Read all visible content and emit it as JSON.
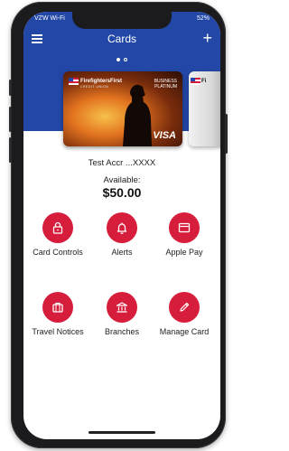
{
  "status": {
    "carrier": "VZW Wi-Fi",
    "battery": "52%"
  },
  "header": {
    "title": "Cards"
  },
  "card": {
    "brand": "FirefightersFirst",
    "brand_sub": "CREDIT UNION",
    "tier": [
      "BUSINESS",
      "PLATINUM"
    ],
    "network": "VISA",
    "next_card_brand": "Fi"
  },
  "account": {
    "name": "Test Accr ...XXXX",
    "available_label": "Available:",
    "available_amount": "$50.00"
  },
  "actions": [
    {
      "label": "Card Controls",
      "icon": "lock-icon"
    },
    {
      "label": "Alerts",
      "icon": "bell-icon"
    },
    {
      "label": "Apple Pay",
      "icon": "wallet-icon"
    },
    {
      "label": "Travel Notices",
      "icon": "suitcase-icon"
    },
    {
      "label": "Branches",
      "icon": "bank-icon"
    },
    {
      "label": "Manage Card",
      "icon": "pencil-icon"
    }
  ],
  "colors": {
    "header_blue": "#2347a7",
    "action_red": "#d71d3c"
  }
}
